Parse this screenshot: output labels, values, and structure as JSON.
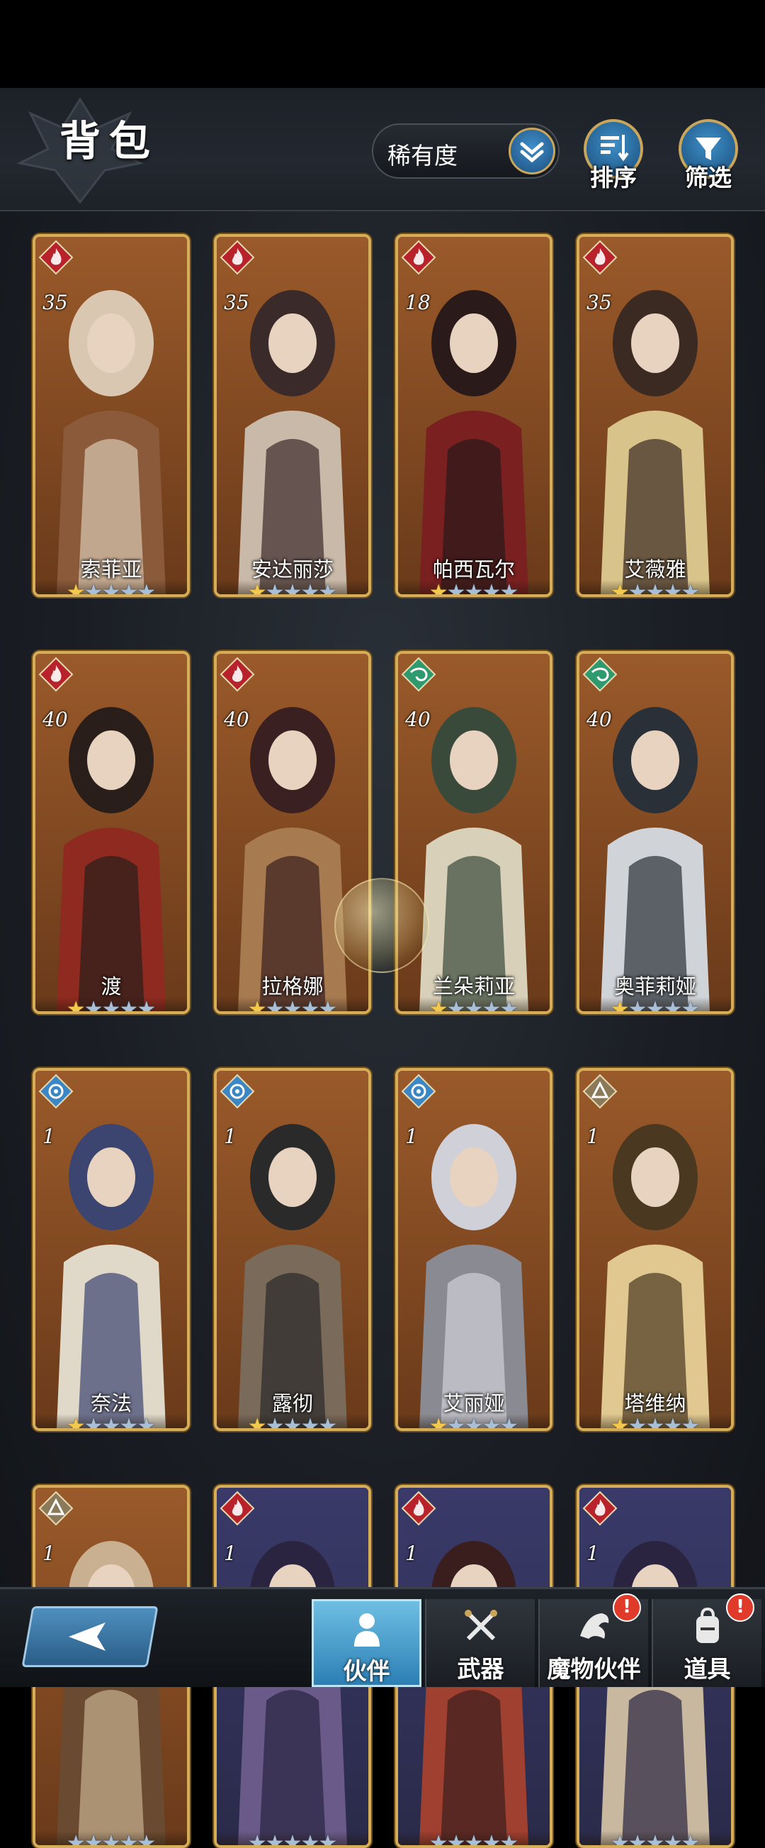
{
  "header": {
    "title": "背包",
    "sort_label": "稀有度",
    "sort_button": "排序",
    "filter_button": "筛选"
  },
  "characters": [
    {
      "name": "索菲亚",
      "level": "35",
      "element": "fire",
      "stars": 1,
      "max_stars": 5
    },
    {
      "name": "安达丽莎",
      "level": "35",
      "element": "fire",
      "stars": 1,
      "max_stars": 5
    },
    {
      "name": "帕西瓦尔",
      "level": "18",
      "element": "fire",
      "stars": 1,
      "max_stars": 5
    },
    {
      "name": "艾薇雅",
      "level": "35",
      "element": "fire",
      "stars": 1,
      "max_stars": 5
    },
    {
      "name": "渡",
      "level": "40",
      "element": "fire",
      "stars": 1,
      "max_stars": 5
    },
    {
      "name": "拉格娜",
      "level": "40",
      "element": "fire",
      "stars": 1,
      "max_stars": 5
    },
    {
      "name": "兰朵莉亚",
      "level": "40",
      "element": "wind",
      "stars": 1,
      "max_stars": 5
    },
    {
      "name": "奥菲莉娅",
      "level": "40",
      "element": "wind",
      "stars": 1,
      "max_stars": 5
    },
    {
      "name": "奈法",
      "level": "1",
      "element": "water",
      "stars": 1,
      "max_stars": 5
    },
    {
      "name": "露彻",
      "level": "1",
      "element": "water",
      "stars": 1,
      "max_stars": 5
    },
    {
      "name": "艾丽娅",
      "level": "1",
      "element": "water",
      "stars": 1,
      "max_stars": 5
    },
    {
      "name": "塔维纳",
      "level": "1",
      "element": "earth",
      "stars": 1,
      "max_stars": 5
    },
    {
      "name": "",
      "level": "1",
      "element": "earth",
      "stars": 0,
      "max_stars": 5
    },
    {
      "name": "",
      "level": "1",
      "element": "fire",
      "stars": 0,
      "max_stars": 5
    },
    {
      "name": "",
      "level": "1",
      "element": "fire",
      "stars": 0,
      "max_stars": 5
    },
    {
      "name": "",
      "level": "1",
      "element": "fire",
      "stars": 0,
      "max_stars": 5
    }
  ],
  "tabs": [
    {
      "label": "伙伴",
      "icon": "partner-icon",
      "active": true,
      "badge": ""
    },
    {
      "label": "武器",
      "icon": "crossed-swords-icon",
      "active": false,
      "badge": ""
    },
    {
      "label": "魔物伙伴",
      "icon": "dragon-icon",
      "active": false,
      "badge": "!"
    },
    {
      "label": "道具",
      "icon": "backpack-icon",
      "active": false,
      "badge": "!"
    }
  ],
  "colors": {
    "fire": "#b8222a",
    "wind": "#2e9a6e",
    "water": "#3b86c4",
    "earth": "#8a7a5a",
    "card_frame": "#d6ad58",
    "accent_blue": "#3d8fc8"
  }
}
